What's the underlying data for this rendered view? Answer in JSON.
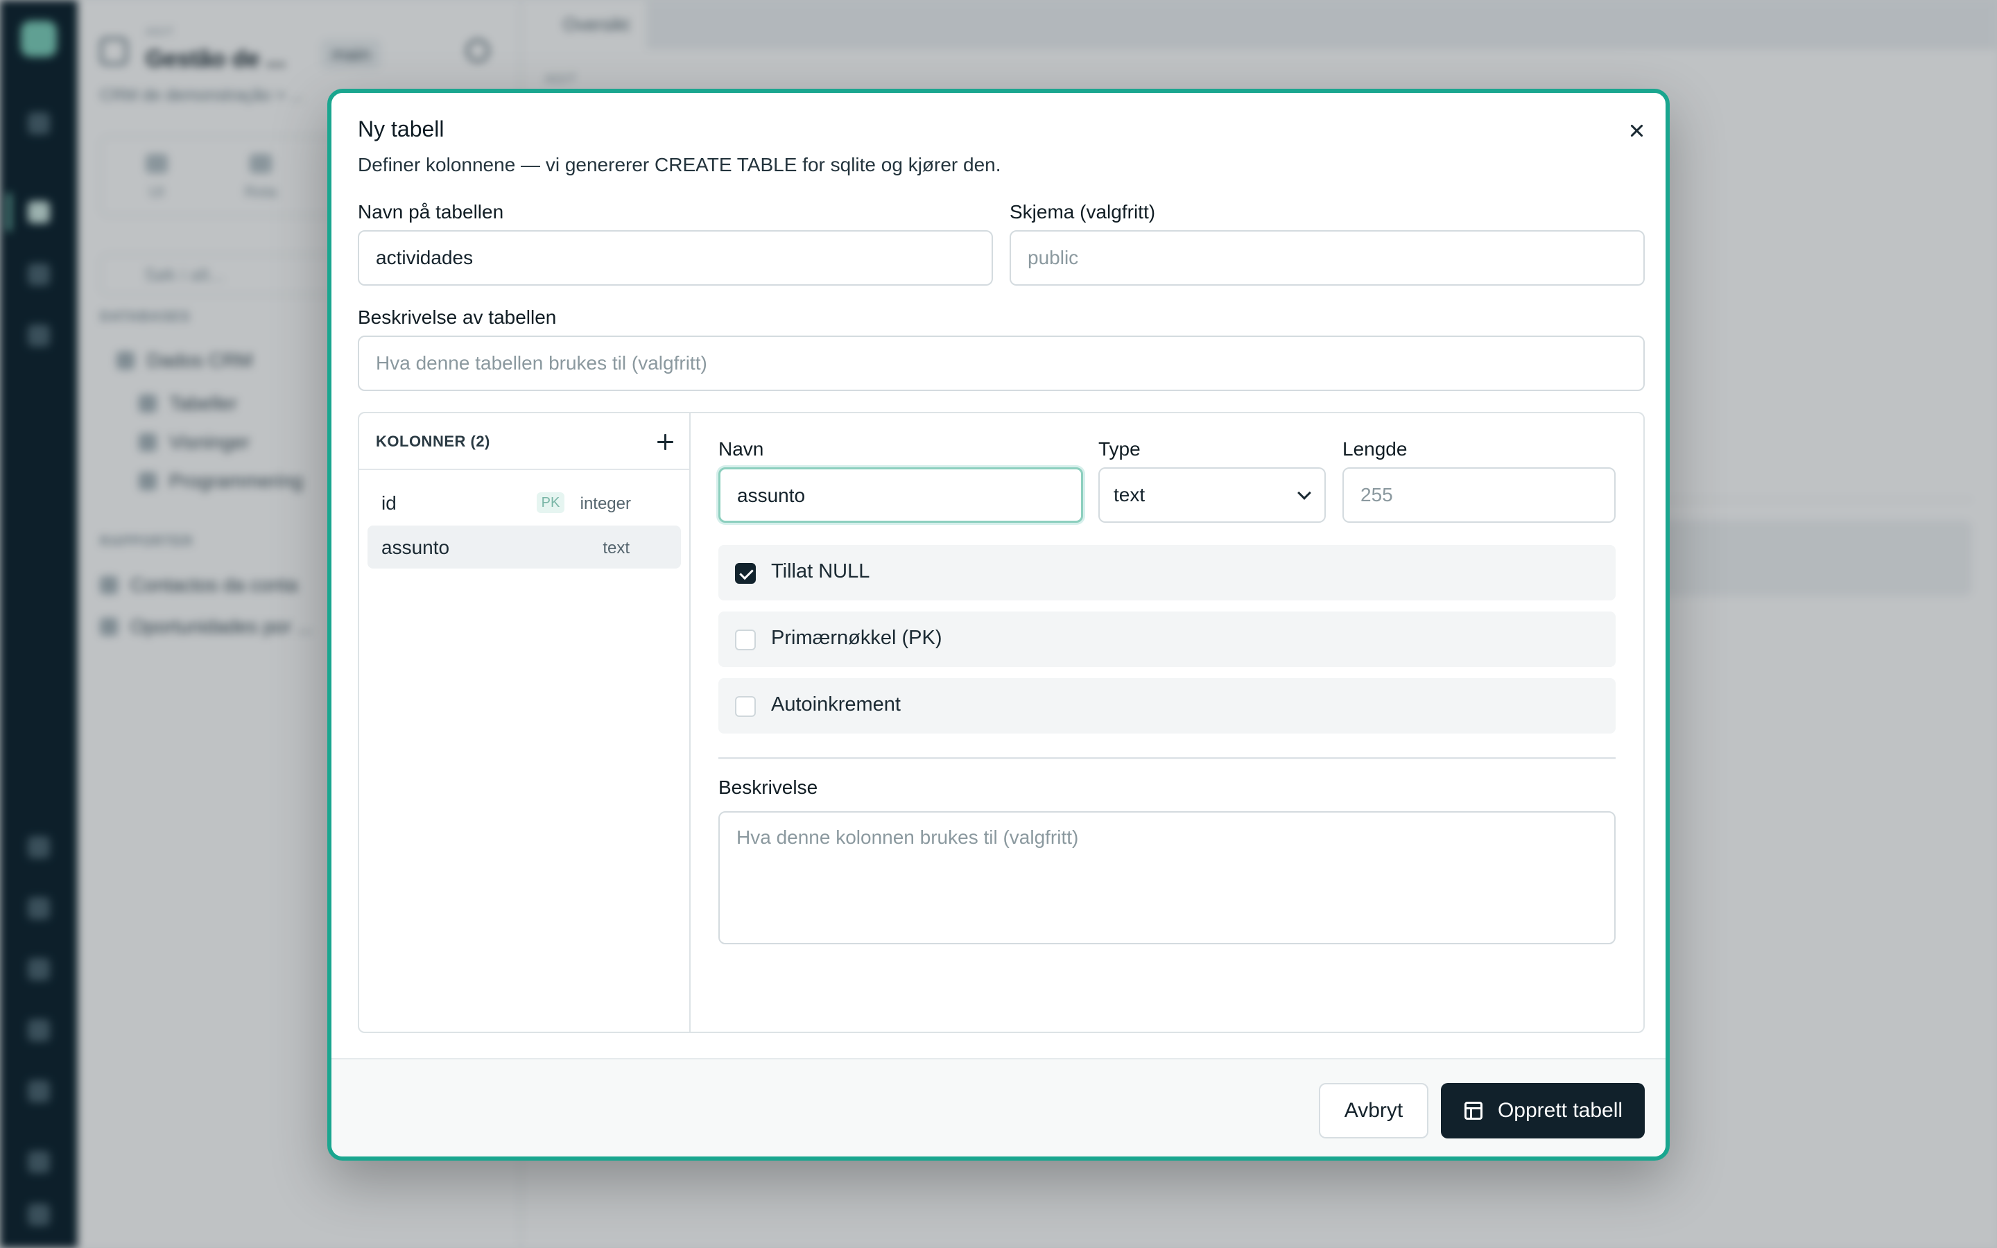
{
  "background": {
    "project_caption": "AGIT",
    "project_name": "Gestão de ...",
    "branch": "main",
    "breadcrumb": "CRM de demonstração > ...",
    "quick_actions": [
      "UI",
      "Rota"
    ],
    "search_placeholder": "Søk i alt...",
    "section_databases": "DATABASES",
    "tree": [
      "Dados CRM",
      "Tabeller",
      "Visninger",
      "Programmering"
    ],
    "section_reports": "RAPPORTER",
    "reports": [
      "Contactos da conta",
      "Oportunidades por ..."
    ],
    "tab_label": "Oversikt",
    "main_caption": "AGIT"
  },
  "modal": {
    "title": "Ny tabell",
    "subtitle": "Definer kolonnene — vi genererer CREATE TABLE for sqlite og kjører den.",
    "table_name_label": "Navn på tabellen",
    "table_name_value": "actividades",
    "schema_label": "Skjema (valgfritt)",
    "schema_placeholder": "public",
    "description_label": "Beskrivelse av tabellen",
    "description_placeholder": "Hva denne tabellen brukes til (valgfritt)",
    "columns_header": "KOLONNER (2)",
    "columns": [
      {
        "name": "id",
        "pk_badge": "PK",
        "type": "integer"
      },
      {
        "name": "assunto",
        "type": "text"
      }
    ],
    "editor": {
      "name_label": "Navn",
      "name_value": "assunto",
      "type_label": "Type",
      "type_value": "text",
      "length_label": "Lengde",
      "length_placeholder": "255",
      "allow_null": "Tillat NULL",
      "primary_key": "Primærnøkkel (PK)",
      "autoincrement": "Autoinkrement",
      "description_label": "Beskrivelse",
      "description_placeholder": "Hva denne kolonnen brukes til (valgfritt)"
    },
    "cancel": "Avbryt",
    "submit": "Opprett tabell"
  },
  "colors": {
    "accent": "#1aa68f",
    "primary_button": "#11212b",
    "rail": "#0f2430"
  },
  "icons": [
    "close-icon",
    "plus-icon",
    "chevron-down-icon",
    "checkbox-checked-icon",
    "table-icon"
  ]
}
